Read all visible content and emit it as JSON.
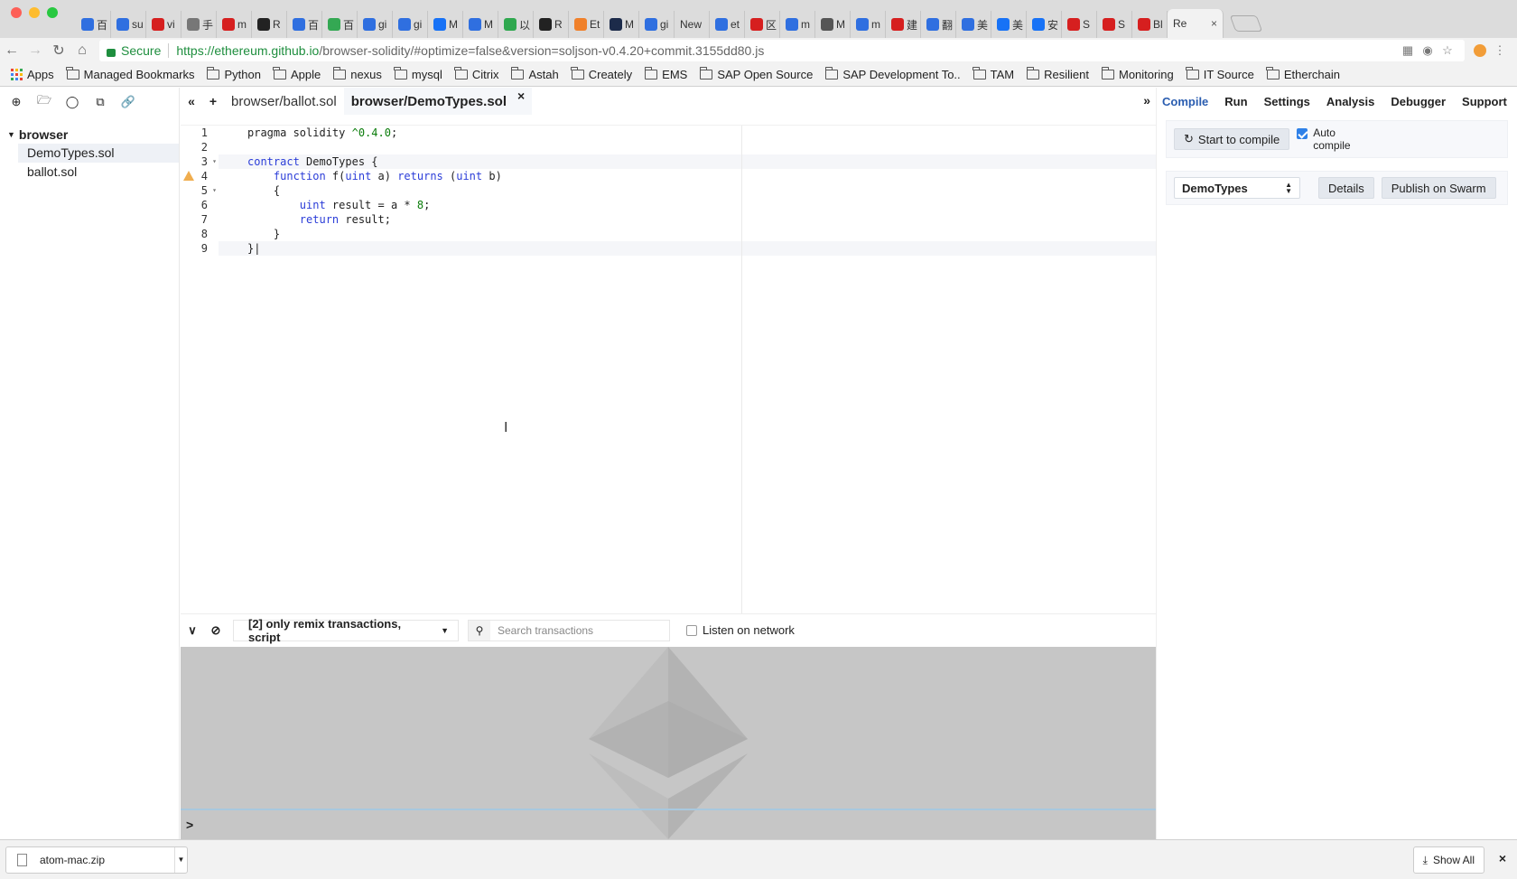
{
  "browser": {
    "tabs": [
      {
        "label": "百",
        "icon": "baidu-paw-icon",
        "color": "#2f6fe0"
      },
      {
        "label": "su",
        "icon": "baidu-paw-icon",
        "color": "#2f6fe0"
      },
      {
        "label": "vi",
        "icon": "csdn-c-icon",
        "color": "#d61f1f"
      },
      {
        "label": "手",
        "icon": "search-person-icon",
        "color": "#777777"
      },
      {
        "label": "m",
        "icon": "csdn-c-icon",
        "color": "#d61f1f"
      },
      {
        "label": "R",
        "icon": "github-icon",
        "color": "#222222"
      },
      {
        "label": "百",
        "icon": "baidu-paw-icon",
        "color": "#2f6fe0"
      },
      {
        "label": "百",
        "icon": "chrome-store-icon",
        "color": "#34a853"
      },
      {
        "label": "gi",
        "icon": "baidu-paw-icon",
        "color": "#2f6fe0"
      },
      {
        "label": "gi",
        "icon": "baidu-paw-icon",
        "color": "#2f6fe0"
      },
      {
        "label": "M",
        "icon": "zhihu-icon",
        "color": "#1772f6"
      },
      {
        "label": "M",
        "icon": "baidu-paw-icon",
        "color": "#2f6fe0"
      },
      {
        "label": "以",
        "icon": "shield-green-icon",
        "color": "#2fa84f"
      },
      {
        "label": "R",
        "icon": "github-icon",
        "color": "#222222"
      },
      {
        "label": "Et",
        "icon": "diamond-orange-icon",
        "color": "#f0802a"
      },
      {
        "label": "M",
        "icon": "circle-dark-icon",
        "color": "#1c2b4a"
      },
      {
        "label": "gi",
        "icon": "baidu-paw-icon",
        "color": "#2f6fe0"
      },
      {
        "label": "New",
        "icon": "",
        "color": "#dcdcdc"
      },
      {
        "label": "et",
        "icon": "baidu-paw-icon",
        "color": "#2f6fe0"
      },
      {
        "label": "区",
        "icon": "csdn-c-icon",
        "color": "#d61f1f"
      },
      {
        "label": "m",
        "icon": "baidu-paw-icon",
        "color": "#2f6fe0"
      },
      {
        "label": "M",
        "icon": "apple-icon",
        "color": "#555555"
      },
      {
        "label": "m",
        "icon": "baidu-paw-icon",
        "color": "#2f6fe0"
      },
      {
        "label": "建",
        "icon": "csdn-c-icon",
        "color": "#d61f1f"
      },
      {
        "label": "翻",
        "icon": "baidu-paw-icon",
        "color": "#2f6fe0"
      },
      {
        "label": "美",
        "icon": "baidu-paw-icon",
        "color": "#2f6fe0"
      },
      {
        "label": "美",
        "icon": "jianshu-icon",
        "color": "#1772f6"
      },
      {
        "label": "安",
        "icon": "jianshu-icon",
        "color": "#1772f6"
      },
      {
        "label": "S",
        "icon": "red-shield-icon",
        "color": "#d61f1f"
      },
      {
        "label": "S",
        "icon": "red-shield-icon",
        "color": "#d61f1f"
      },
      {
        "label": "Bl",
        "icon": "red-shield-icon",
        "color": "#d61f1f"
      }
    ],
    "active_tab": {
      "label": "Re",
      "close": "×"
    },
    "address": {
      "secure_label": "Secure",
      "url_host": "https://ethereum.github.io",
      "url_path": "/browser-solidity/#optimize=false&version=soljson-v0.4.20+commit.3155dd80.js"
    },
    "bookmarks": [
      {
        "label": "Apps",
        "type": "apps"
      },
      {
        "label": "Managed Bookmarks",
        "type": "folder"
      },
      {
        "label": "Python",
        "type": "folder"
      },
      {
        "label": "Apple",
        "type": "folder"
      },
      {
        "label": "nexus",
        "type": "folder"
      },
      {
        "label": "mysql",
        "type": "folder"
      },
      {
        "label": "Citrix",
        "type": "folder"
      },
      {
        "label": "Astah",
        "type": "folder"
      },
      {
        "label": "Creately",
        "type": "folder"
      },
      {
        "label": "EMS",
        "type": "folder"
      },
      {
        "label": "SAP Open Source",
        "type": "folder"
      },
      {
        "label": "SAP Development To..",
        "type": "folder"
      },
      {
        "label": "TAM",
        "type": "folder"
      },
      {
        "label": "Resilient",
        "type": "folder"
      },
      {
        "label": "Monitoring",
        "type": "folder"
      },
      {
        "label": "IT Source",
        "type": "folder"
      },
      {
        "label": "Etherchain",
        "type": "folder"
      }
    ]
  },
  "remix": {
    "file_explorer": {
      "root": "browser",
      "files": [
        "DemoTypes.sol",
        "ballot.sol"
      ]
    },
    "editor": {
      "tabs": [
        "browser/ballot.sol",
        "browser/DemoTypes.sol"
      ],
      "active_tab_index": 1,
      "close_glyph": "×",
      "collapse_glyph": "«",
      "add_glyph": "+",
      "expand_glyph": "»",
      "line_numbers": [
        "1",
        "2",
        "3",
        "4",
        "5",
        "6",
        "7",
        "8",
        "9"
      ],
      "warning_line": 4
    },
    "terminal": {
      "filter_label": "[2] only remix transactions, script",
      "search_placeholder": "Search transactions",
      "listen_label": "Listen on network",
      "prompt": ">"
    },
    "right_panel": {
      "tabs": [
        "Compile",
        "Run",
        "Settings",
        "Analysis",
        "Debugger",
        "Support"
      ],
      "active_tab": "Compile",
      "compile_button": "Start to compile",
      "auto_compile_label": "Auto compile",
      "auto_compile_checked": true,
      "contract_selected": "DemoTypes",
      "details_button": "Details",
      "publish_button": "Publish on Swarm"
    }
  },
  "downloads": {
    "file": "atom-mac.zip",
    "show_all": "Show All",
    "close": "×"
  },
  "colors": {
    "accent": "#2a5db0",
    "secure_green": "#1e8e3e",
    "warning": "#f0ad4e",
    "keyword": "#2b3dd8",
    "number": "#0a7c0a",
    "terminal_bg": "#c6c6c6"
  }
}
